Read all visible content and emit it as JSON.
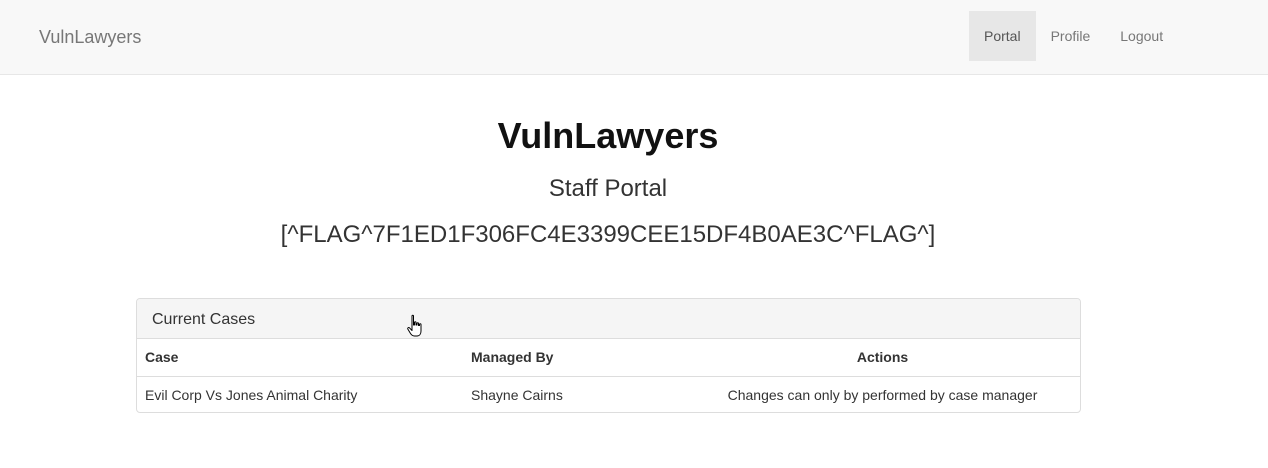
{
  "navbar": {
    "brand": "VulnLawyers",
    "items": [
      {
        "label": "Portal",
        "active": true
      },
      {
        "label": "Profile",
        "active": false
      },
      {
        "label": "Logout",
        "active": false
      }
    ]
  },
  "header": {
    "title": "VulnLawyers",
    "subtitle": "Staff Portal",
    "flag": "[^FLAG^7F1ED1F306FC4E3399CEE15DF4B0AE3C^FLAG^]"
  },
  "cases_panel": {
    "heading": "Current Cases",
    "columns": [
      "Case",
      "Managed By",
      "Actions"
    ],
    "rows": [
      {
        "case": "Evil Corp Vs Jones Animal Charity",
        "managed_by": "Shayne Cairns",
        "actions": "Changes can only by performed by case manager"
      }
    ]
  },
  "colors": {
    "navbar_bg": "#f8f8f8",
    "nav_active_bg": "#e7e7e7",
    "panel_heading_bg": "#f5f5f5",
    "border": "#dddddd"
  },
  "icons": {
    "cursor": "hand-pointer-icon"
  }
}
